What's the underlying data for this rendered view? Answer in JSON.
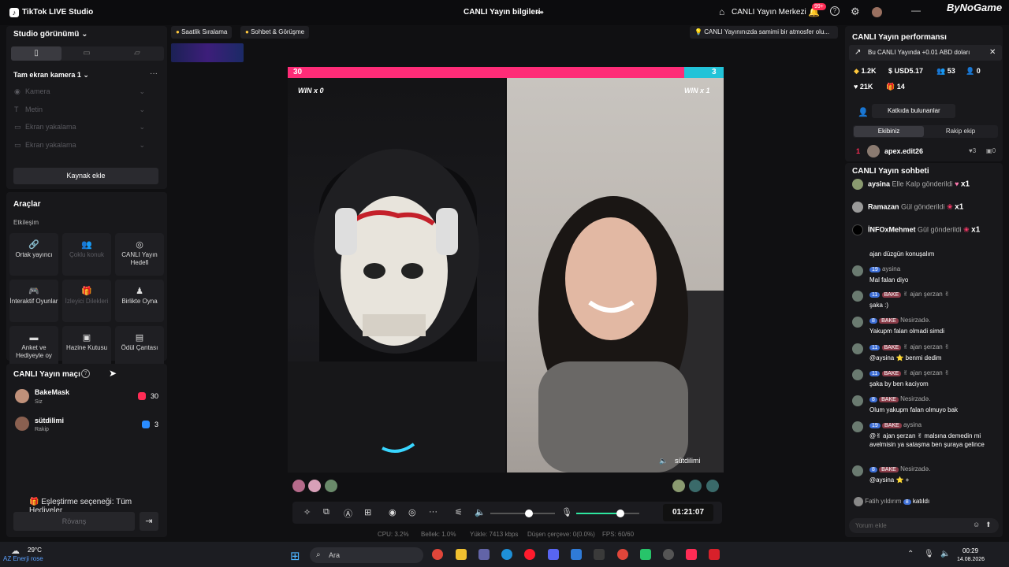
{
  "app": {
    "title": "TikTok LIVE Studio",
    "center_title": "CANLI Yayın bilgileri",
    "live_center": "CANLI Yayın Merkezi",
    "notif_badge": "99+",
    "watermark": "ByNoGame"
  },
  "left": {
    "studio_title": "Studio görünümü",
    "scene_title": "Tam ekran kamera 1",
    "sources": [
      "Kamera",
      "Metin",
      "Ekran yakalama",
      "Ekran yakalama"
    ],
    "add_source": "Kaynak ekle",
    "tools_title": "Araçlar",
    "tools_sub": "Etkileşim",
    "tools": [
      {
        "label": "Ortak yayıncı",
        "icon": "🔗",
        "disabled": false
      },
      {
        "label": "Çoklu konuk",
        "icon": "👥",
        "disabled": true
      },
      {
        "label": "CANLI Yayın Hedefi",
        "icon": "◎",
        "disabled": false
      },
      {
        "label": "İnteraktif Oyunlar",
        "icon": "🎮",
        "disabled": false
      },
      {
        "label": "İzleyici Dilekleri",
        "icon": "🎁",
        "disabled": true
      },
      {
        "label": "Birlikte Oyna",
        "icon": "♟",
        "disabled": false
      },
      {
        "label": "Anket ve Hediyeyle oy",
        "icon": "▬",
        "disabled": false
      },
      {
        "label": "Hazine Kutusu",
        "icon": "▣",
        "disabled": false
      },
      {
        "label": "Ödül Çantası",
        "icon": "▤",
        "disabled": false
      }
    ],
    "match_title": "CANLI Yayın maçı",
    "match": [
      {
        "name": "BakeMask",
        "sub": "Siz",
        "score": "30"
      },
      {
        "name": "sütdilimi",
        "sub": "Rakip",
        "score": "3"
      }
    ],
    "pair_option": "Eşleştirme seçeneği: Tüm Hediyeler",
    "rematch": "Rövanş"
  },
  "center": {
    "chip1": "Saatlik Sıralama",
    "chip2": "Sohbet & Görüşme",
    "chip3": "CANLI Yayınınızda samimi bir atmosfer olu...",
    "score_left": "30",
    "score_right": "3",
    "score_left_share": 0.91,
    "win_left": "WIN x 0",
    "win_right": "WIN x 1",
    "opponent_name": "sütdilimi",
    "timer": "01:21:07",
    "volume_level": 0.6,
    "mic_level": 0.7,
    "stats": {
      "cpu": "CPU: 3.2%",
      "mem": "Bellek: 1.0%",
      "upload": "Yükle: 7413 kbps",
      "drop": "Düşen çerçeve: 0(0.0%)",
      "fps": "FPS: 60/60"
    }
  },
  "right": {
    "perf_title": "CANLI Yayın performansı",
    "perf_note": "Bu CANLI Yayında +0.01 ABD doları",
    "stats": [
      "1.2K",
      "USD5.17",
      "53",
      "0",
      "21K",
      "14"
    ],
    "contrib_btn": "Katkıda bulunanlar",
    "team_mine": "Ekibiniz",
    "team_rival": "Rakip ekip",
    "contributor": {
      "rank": "1",
      "name": "apex.edit26",
      "hearts": "3",
      "gifts": "0"
    },
    "chat_title": "CANLI Yayın sohbeti",
    "gifts": [
      {
        "name": "aysina",
        "text": "Elle Kalp gönderildi",
        "count": "x1"
      },
      {
        "name": "Ramazan",
        "text": "Gül gönderildi",
        "count": "x1"
      },
      {
        "name": "İNFOxMehmet",
        "text": "Gül gönderildi",
        "count": "x1"
      }
    ],
    "top_cut": "ajan düzgün konuşalım",
    "messages": [
      {
        "lvl": "19",
        "tag": "",
        "user": "aysina",
        "text": "Mal falan diyo"
      },
      {
        "lvl": "11",
        "tag": "BAKE",
        "user": "✌ ajan şerzan ✌",
        "text": "şaka :)"
      },
      {
        "lvl": "8",
        "tag": "BAKE",
        "user": "Nesirzadə.",
        "text": "Yakupm falan olmadi simdi"
      },
      {
        "lvl": "11",
        "tag": "BAKE",
        "user": "✌ ajan şerzan ✌",
        "text": "@aysina ⭐ benmi dedim"
      },
      {
        "lvl": "11",
        "tag": "BAKE",
        "user": "✌ ajan şerzan ✌",
        "text": "şaka by ben kaciyom"
      },
      {
        "lvl": "8",
        "tag": "BAKE",
        "user": "Nesirzadə.",
        "text": "Olum yakupm falan olmuyo bak"
      },
      {
        "lvl": "19",
        "tag": "BAKE",
        "user": "aysina",
        "text": "@✌ ajan şerzan ✌ malsına demedin mi avelmisin ya sataşma ben şuraya gelince"
      },
      {
        "lvl": "8",
        "tag": "BAKE",
        "user": "Nesirzadə.",
        "text": "@aysina ⭐ +"
      }
    ],
    "join": {
      "name": "Fatih yıldırım",
      "lvl": "8",
      "text": "katıldı"
    },
    "comment_placeholder": "Yorum ekle"
  },
  "taskbar": {
    "temp": "29°C",
    "weather": "AZ Enerji rose",
    "search": "Ara",
    "time": "00:29",
    "date": "14.08.2026"
  }
}
